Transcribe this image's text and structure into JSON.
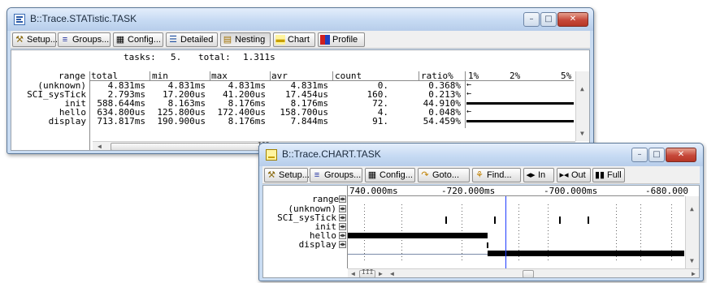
{
  "stat_window": {
    "title": "B::Trace.STATistic.TASK",
    "toolbar": [
      {
        "label": "Setup...",
        "icon": "wrench-icon"
      },
      {
        "label": "Groups...",
        "icon": "groups-icon"
      },
      {
        "label": "Config...",
        "icon": "config-icon"
      },
      {
        "label": "Detailed",
        "icon": "detailed-icon"
      },
      {
        "label": "Nesting",
        "icon": "nesting-icon"
      },
      {
        "label": "Chart",
        "icon": "chart-icon"
      },
      {
        "label": "Profile",
        "icon": "profile-icon"
      }
    ],
    "summary": {
      "tasks_label": "tasks:",
      "tasks_value": "5.",
      "total_label": "total:",
      "total_value": "1.311s"
    },
    "columns": [
      "range",
      "total",
      "min",
      "max",
      "avr",
      "count",
      "ratio%"
    ],
    "scale_labels": [
      "1%",
      "2%",
      "5%"
    ],
    "rows": [
      {
        "range": "(unknown)",
        "total": "4.831ms",
        "min": "4.831ms",
        "max": "4.831ms",
        "avr": "4.831ms",
        "count": "0.",
        "ratio": "0.368%",
        "ratio_pct": 0.368
      },
      {
        "range": "SCI_sysTick",
        "total": "2.793ms",
        "min": "17.200us",
        "max": "41.200us",
        "avr": "17.454us",
        "count": "160.",
        "ratio": "0.213%",
        "ratio_pct": 0.213
      },
      {
        "range": "init",
        "total": "588.644ms",
        "min": "8.163ms",
        "max": "8.176ms",
        "avr": "8.176ms",
        "count": "72.",
        "ratio": "44.910%",
        "ratio_pct": 44.91
      },
      {
        "range": "hello",
        "total": "634.800us",
        "min": "125.800us",
        "max": "172.400us",
        "avr": "158.700us",
        "count": "4.",
        "ratio": "0.048%",
        "ratio_pct": 0.048
      },
      {
        "range": "display",
        "total": "713.817ms",
        "min": "190.900us",
        "max": "8.176ms",
        "avr": "7.844ms",
        "count": "91.",
        "ratio": "54.459%",
        "ratio_pct": 54.459
      }
    ],
    "hscroll_mid": "III"
  },
  "chart_window": {
    "title": "B::Trace.CHART.TASK",
    "toolbar": [
      {
        "label": "Setup...",
        "icon": "wrench-icon"
      },
      {
        "label": "Groups...",
        "icon": "groups-icon"
      },
      {
        "label": "Config...",
        "icon": "config-icon"
      },
      {
        "label": "Goto...",
        "icon": "goto-icon"
      },
      {
        "label": "Find...",
        "icon": "find-icon"
      },
      {
        "label": "In",
        "icon": "zoom-in-icon"
      },
      {
        "label": "Out",
        "icon": "zoom-out-icon"
      },
      {
        "label": "Full",
        "icon": "zoom-full-icon"
      }
    ],
    "range_label": "range",
    "time_labels": [
      "740.000ms",
      "-720.000ms",
      "-700.000ms",
      "-680.000"
    ],
    "rows": [
      "(unknown)",
      "SCI_sysTick",
      "init",
      "hello",
      "display"
    ],
    "hscroll_mid": "III"
  },
  "colors": {
    "title_gradient_top": "#e4eefb",
    "close_red": "#c6483a",
    "cursor_blue": "#1f3cff",
    "bar": "#000000"
  }
}
